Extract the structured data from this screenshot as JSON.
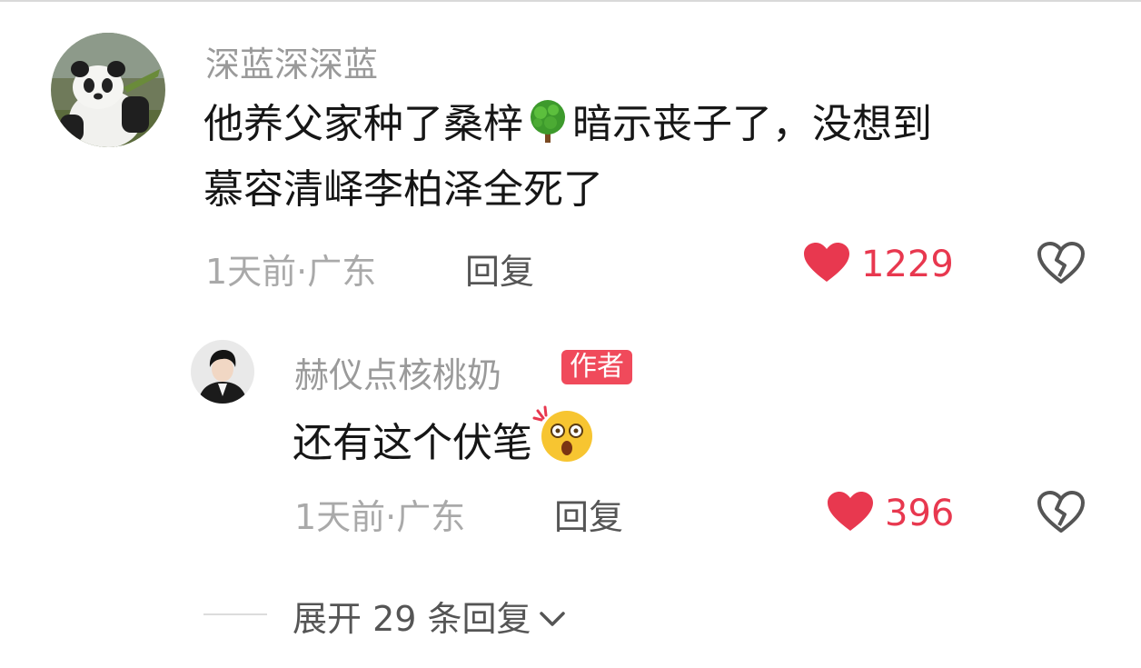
{
  "comment": {
    "username": "深蓝深深蓝",
    "text_line1_a": "他养父家种了桑梓",
    "text_line1_emoji": "tree-emoji",
    "text_line1_b": "暗示丧子了，没想到",
    "text_line2": "慕容清峄李柏泽全死了",
    "meta": "1天前·广东",
    "reply_label": "回复",
    "like_count": "1229"
  },
  "reply": {
    "username": "赫仪点核桃奶",
    "badge": "作者",
    "text": "还有这个伏笔",
    "text_emoji": "shocked-face-emoji",
    "meta": "1天前·广东",
    "reply_label": "回复",
    "like_count": "396"
  },
  "expand": {
    "label": "展开 29 条回复"
  },
  "colors": {
    "accent_red": "#e8384f",
    "badge_red": "#f04a5b",
    "meta_gray": "#a9a9a9"
  }
}
